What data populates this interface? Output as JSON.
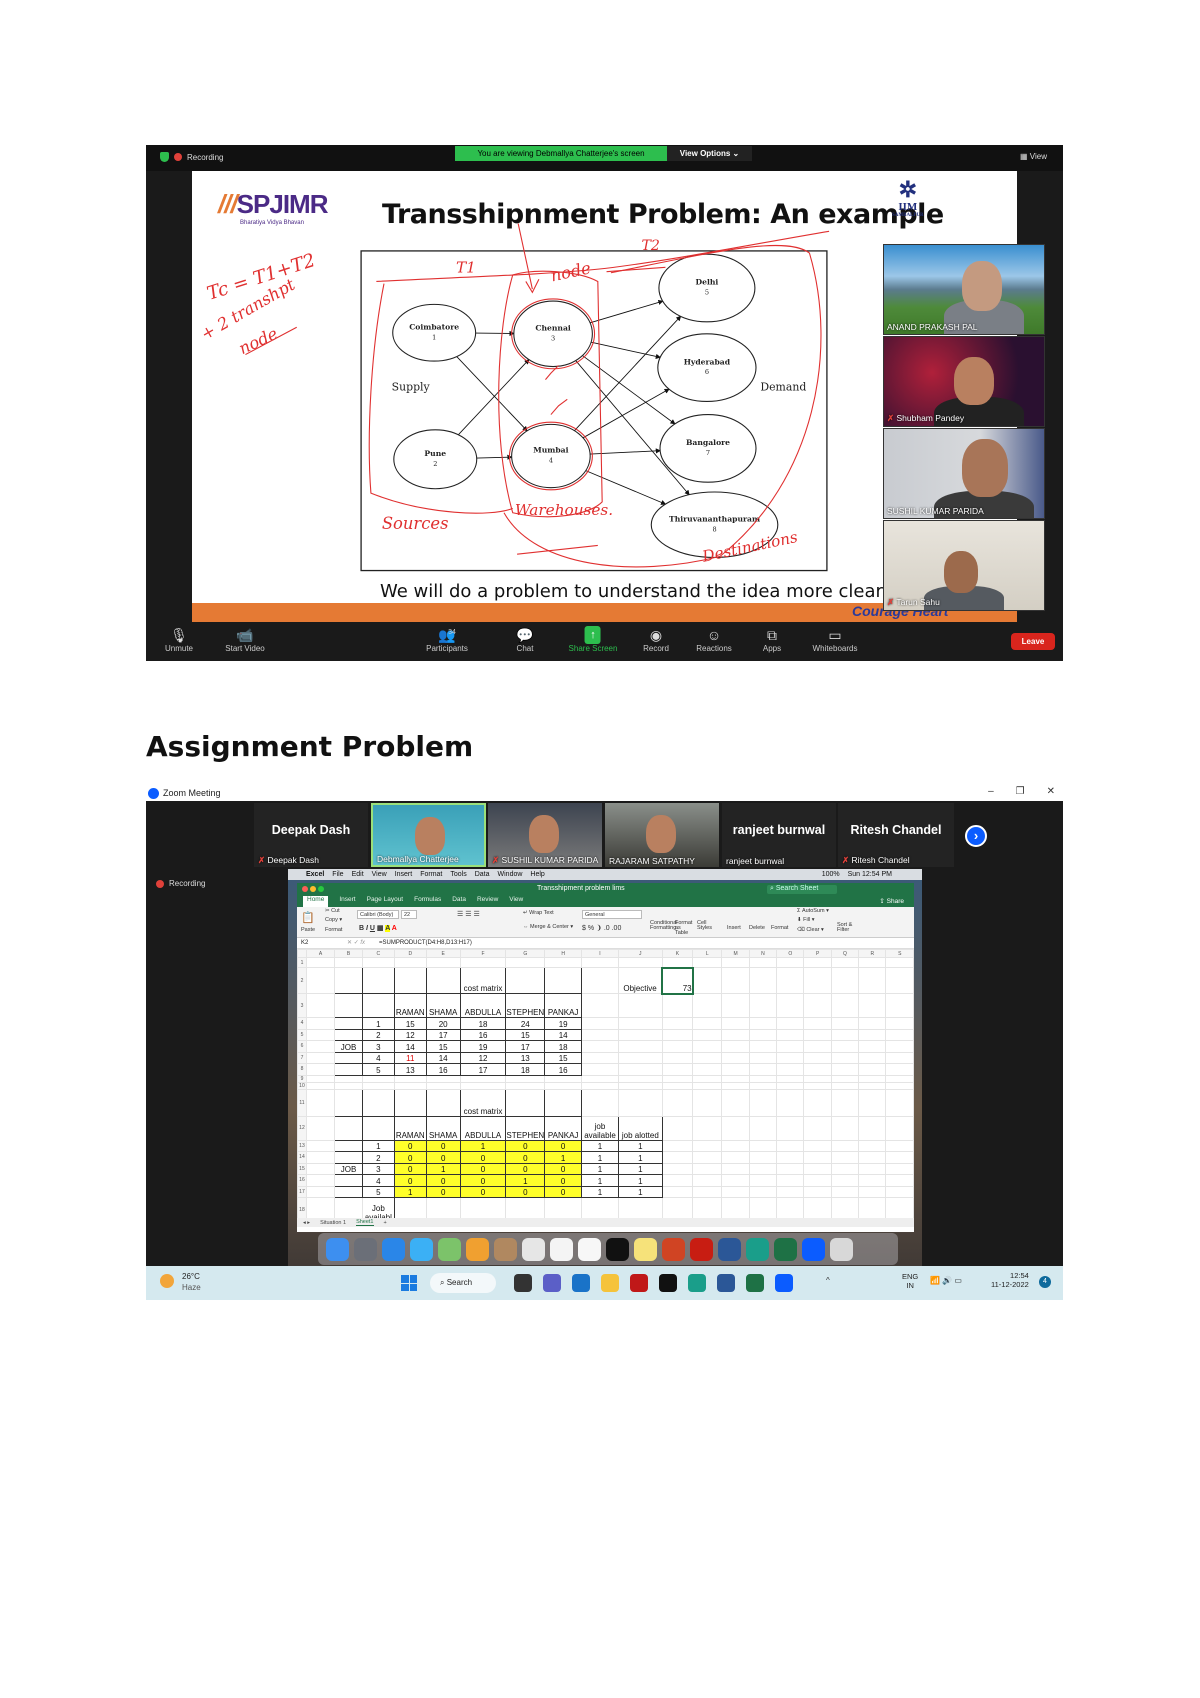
{
  "top_meeting": {
    "recording_label": "Recording",
    "banner": "You are viewing Debmallya Chatterjee's screen",
    "view_options": "View Options ⌄",
    "view_label": "View",
    "slide": {
      "logo_left": "SPJIMR",
      "logo_left_sub": "Bharatiya Vidya Bhavan",
      "logo_right": "IIM",
      "logo_right_sub": "SAMBALPUR",
      "title": "Transshipnment Problem: An example",
      "footer": "We will do a problem to understand the idea more clearly!",
      "tagline": "Courage   Heart",
      "diagram": {
        "supply_label": "Supply",
        "demand_label": "Demand",
        "nodes": [
          {
            "name": "Coimbatore",
            "num": "1"
          },
          {
            "name": "Pune",
            "num": "2"
          },
          {
            "name": "Chennai",
            "num": "3"
          },
          {
            "name": "Mumbai",
            "num": "4"
          },
          {
            "name": "Delhi",
            "num": "5"
          },
          {
            "name": "Hyderabad",
            "num": "6"
          },
          {
            "name": "Bangalore",
            "num": "7"
          },
          {
            "name": "Thiruvananthapuram",
            "num": "8"
          }
        ]
      },
      "annotations": {
        "formula": "Tc = T1+T2",
        "formula2": "+ 2 transhpt",
        "formula3": "node",
        "t1": "T1",
        "t2": "T2",
        "node": "node",
        "sources": "Sources",
        "warehouses": "Warehouses.",
        "destinations": "Destinations"
      }
    },
    "gallery": [
      "ANAND PRAKASH PAL",
      "Shubham Pandey",
      "SUSHIL KUMAR PARIDA",
      "Tarun Sahu"
    ],
    "toolbar": [
      {
        "label": "Unmute",
        "icon": "mic-muted-icon"
      },
      {
        "label": "Start Video",
        "icon": "video-off-icon"
      },
      {
        "label": "Participants",
        "icon": "participants-icon",
        "count": "34"
      },
      {
        "label": "Chat",
        "icon": "chat-icon"
      },
      {
        "label": "Share Screen",
        "icon": "share-screen-icon"
      },
      {
        "label": "Record",
        "icon": "record-icon"
      },
      {
        "label": "Reactions",
        "icon": "reactions-icon"
      },
      {
        "label": "Apps",
        "icon": "apps-icon"
      },
      {
        "label": "Whiteboards",
        "icon": "whiteboard-icon"
      }
    ],
    "leave_label": "Leave"
  },
  "heading": "Assignment Problem",
  "bottom_meeting": {
    "window_title": "Zoom Meeting",
    "recording_label": "Recording",
    "participants": [
      {
        "big": "Deepak Dash",
        "name": "Deepak Dash",
        "muted": true,
        "video": false
      },
      {
        "big": "",
        "name": "Debmallya Chatterjee",
        "muted": false,
        "video": true
      },
      {
        "big": "",
        "name": "SUSHIL KUMAR PARIDA",
        "muted": true,
        "video": true
      },
      {
        "big": "",
        "name": "RAJARAM SATPATHY",
        "muted": false,
        "video": true
      },
      {
        "big": "ranjeet burnwal",
        "name": "ranjeet burnwal",
        "muted": false,
        "video": false
      },
      {
        "big": "Ritesh Chandel",
        "name": "Ritesh Chandel",
        "muted": true,
        "video": false
      }
    ],
    "mac_menu": [
      "Excel",
      "File",
      "Edit",
      "View",
      "Insert",
      "Format",
      "Tools",
      "Data",
      "Window",
      "Help"
    ],
    "mac_status": {
      "battery": "100%",
      "clock": "Sun 12:54 PM"
    },
    "excel": {
      "file_title": "Transshipment problem lims",
      "search_placeholder": "Search Sheet",
      "share_label": "Share",
      "tabs": [
        "Home",
        "Insert",
        "Page Layout",
        "Formulas",
        "Data",
        "Review",
        "View"
      ],
      "ribbon": {
        "paste": "Paste",
        "cut": "Cut",
        "copy": "Copy ▾",
        "format": "Format",
        "font": "Calibri (Body)",
        "size": "22",
        "wrap": "Wrap Text",
        "merge": "Merge & Center ▾",
        "number_format": "General",
        "cond": "Conditional Formatting",
        "fmt_table": "Format as Table",
        "cell_styles": "Cell Styles",
        "insert": "Insert",
        "delete": "Delete",
        "format2": "Format",
        "autosum": "AutoSum ▾",
        "fill": "Fill ▾",
        "clear": "Clear ▾",
        "sort": "Sort & Filter"
      },
      "cell_ref": "K2",
      "formula": "=SUMPRODUCT(D4:H8,D13:H17)",
      "columns": [
        "A",
        "B",
        "C",
        "D",
        "E",
        "F",
        "G",
        "H",
        "I",
        "J",
        "K",
        "L",
        "M",
        "N",
        "O",
        "P",
        "Q",
        "R",
        "S"
      ],
      "cost_matrix_label": "cost matrix",
      "objective_label": "Objective",
      "objective_value": "73",
      "people": [
        "RAMAN",
        "SHAMA",
        "ABDULLA",
        "STEPHEN",
        "PANKAJ"
      ],
      "job_label": "JOB",
      "jobs": [
        "1",
        "2",
        "3",
        "4",
        "5"
      ],
      "cost_matrix": [
        [
          15,
          20,
          18,
          24,
          19
        ],
        [
          12,
          17,
          16,
          15,
          14
        ],
        [
          14,
          15,
          19,
          17,
          18
        ],
        [
          11,
          14,
          12,
          13,
          15
        ],
        [
          13,
          16,
          17,
          18,
          16
        ]
      ],
      "assignment": [
        [
          0,
          0,
          1,
          0,
          0
        ],
        [
          0,
          0,
          0,
          0,
          1
        ],
        [
          0,
          1,
          0,
          0,
          0
        ],
        [
          0,
          0,
          0,
          1,
          0
        ],
        [
          1,
          0,
          0,
          0,
          0
        ]
      ],
      "job_available_label": "job available",
      "job_alotted_label": "job alotted",
      "job_available": [
        1,
        1,
        1,
        1,
        1
      ],
      "job_alotted": [
        1,
        1,
        1,
        1,
        1
      ],
      "row18_label": "Job availabl",
      "sheet_tabs": [
        "Situation 1",
        "Sheet1"
      ],
      "active_sheet": "Sheet1"
    },
    "taskbar": {
      "temp": "26°C",
      "weather": "Haze",
      "search": "Search",
      "lang": "ENG",
      "region": "IN",
      "time": "12:54",
      "date": "11-12-2022",
      "notifications": "4"
    }
  }
}
